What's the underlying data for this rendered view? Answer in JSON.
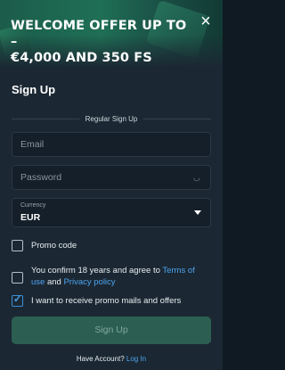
{
  "banner": {
    "title_line1": "WELCOME OFFER UP TO –",
    "title_line2": "€4,000 AND 350 FS"
  },
  "close_label": "×",
  "form": {
    "heading": "Sign Up",
    "divider_label": "Regular Sign Up",
    "email": {
      "placeholder": "Email",
      "value": ""
    },
    "password": {
      "placeholder": "Password",
      "value": ""
    },
    "currency": {
      "label": "Currency",
      "value": "EUR"
    },
    "promo_code": {
      "label": "Promo code",
      "checked": false
    },
    "terms": {
      "text_before": "You confirm 18 years and agree to ",
      "terms_link": "Terms of use",
      "text_middle": " and ",
      "privacy_link": "Privacy policy",
      "checked": false
    },
    "newsletter": {
      "label": "I want to receive promo mails and offers",
      "checked": true
    },
    "submit_label": "Sign Up"
  },
  "footer": {
    "text": "Have Account?",
    "login_link": "Log In"
  }
}
